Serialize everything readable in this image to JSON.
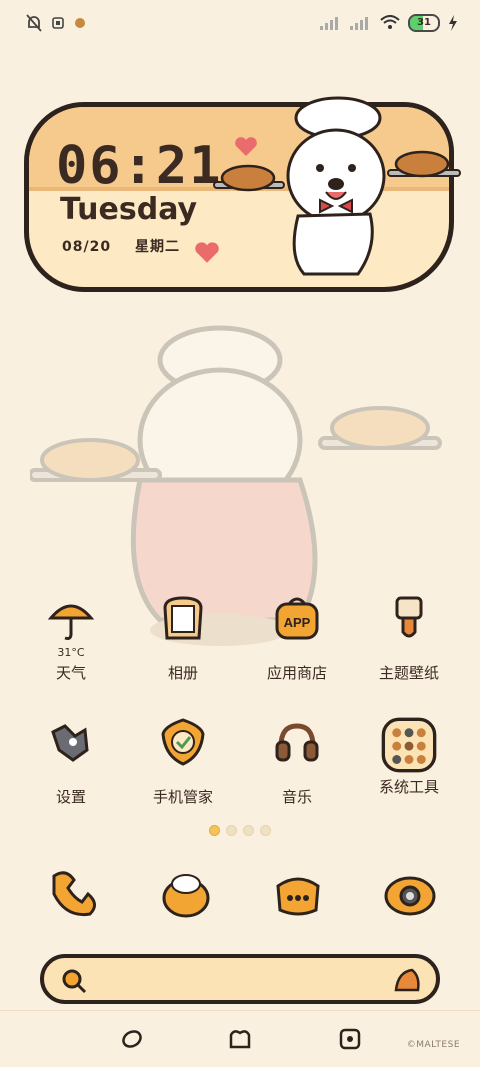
{
  "status_bar": {
    "battery_level": "31",
    "left_icons": [
      "notifications-off-icon",
      "sim-icon",
      "app-notification-icon"
    ],
    "right_icons": [
      "signal-1-icon",
      "signal-2-icon",
      "wifi-icon",
      "battery-icon",
      "charging-icon"
    ]
  },
  "clock_widget": {
    "time": "06:21",
    "day": "Tuesday",
    "date": "08/20",
    "weekday": "星期二"
  },
  "apps": [
    {
      "label": "天气",
      "sub": "31°C",
      "icon": "umbrella-icon"
    },
    {
      "label": "相册",
      "sub": "",
      "icon": "toast-bread-icon"
    },
    {
      "label": "应用商店",
      "sub": "",
      "icon": "app-store-bag-icon"
    },
    {
      "label": "主题壁纸",
      "sub": "",
      "icon": "paint-brush-icon"
    },
    {
      "label": "设置",
      "sub": "",
      "icon": "wrench-settings-icon"
    },
    {
      "label": "手机管家",
      "sub": "",
      "icon": "shield-check-icon"
    },
    {
      "label": "音乐",
      "sub": "",
      "icon": "headphones-icon"
    },
    {
      "label": "系统工具",
      "sub": "",
      "icon": "folder-icon"
    }
  ],
  "app_store_icon_text": "APP",
  "page_dots": {
    "count": 4,
    "active": 0
  },
  "dock": [
    "phone-icon",
    "messages-icon",
    "browser-icon",
    "camera-icon"
  ],
  "search_bar": {
    "icons": [
      "search-icon",
      "assistant-icon"
    ]
  },
  "navbar": [
    "back-icon",
    "home-icon",
    "recents-icon"
  ],
  "credit": "©MALTESE",
  "colors": {
    "background": "#FAF0DF",
    "outline": "#2E221D",
    "bread": "#F6C98D",
    "accent": "#F2C45A"
  }
}
